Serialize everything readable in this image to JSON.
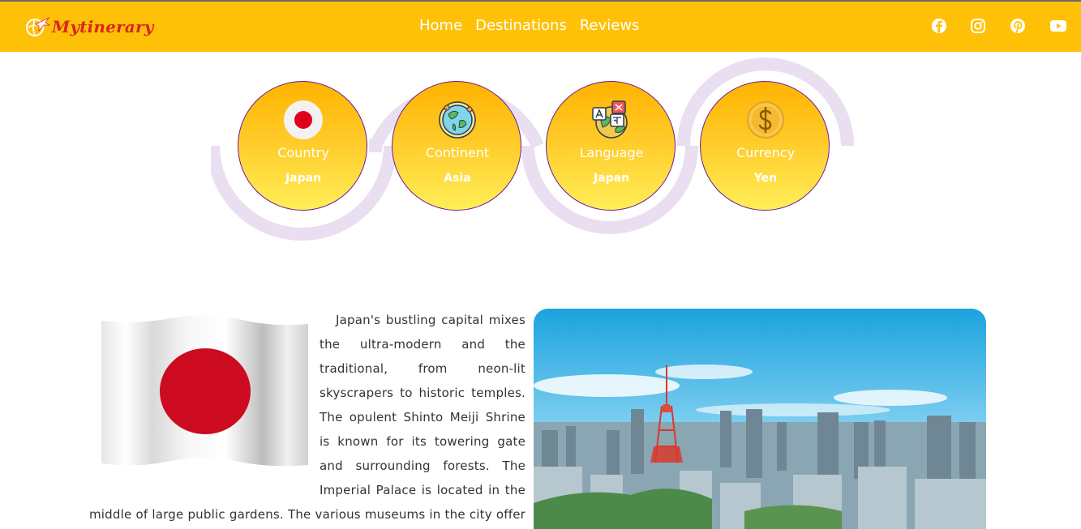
{
  "brand": {
    "name": "Mytinerary"
  },
  "nav": {
    "links": [
      "Home",
      "Destinations",
      "Reviews"
    ]
  },
  "social": {
    "icons": [
      "facebook-icon",
      "instagram-icon",
      "pinterest-icon",
      "youtube-icon"
    ]
  },
  "info": {
    "country": {
      "title": "Country",
      "value": "Japan"
    },
    "continent": {
      "title": "Continent",
      "value": "Asia"
    },
    "language": {
      "title": "Language",
      "value": "Japan"
    },
    "currency": {
      "title": "Currency",
      "value": "Yen"
    }
  },
  "content": {
    "description": "Japan's bustling capital mixes the ultra-modern and the traditional, from neon-lit skyscrapers to historic temples. The opulent Shinto Meiji Shrine is known for its towering gate and surrounding forests. The Imperial Palace is located in the middle of large public gardens. The various museums in the city offer exhibits"
  },
  "colors": {
    "navbar": "#ffc107",
    "brand": "#d9261c",
    "circle_border": "#6a1b9a",
    "arc": "#e9dff1"
  }
}
